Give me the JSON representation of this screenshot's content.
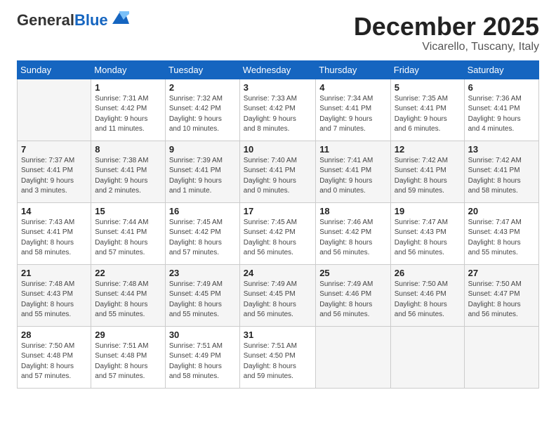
{
  "header": {
    "logo_general": "General",
    "logo_blue": "Blue",
    "title": "December 2025",
    "location": "Vicarello, Tuscany, Italy"
  },
  "days_of_week": [
    "Sunday",
    "Monday",
    "Tuesday",
    "Wednesday",
    "Thursday",
    "Friday",
    "Saturday"
  ],
  "weeks": [
    [
      {
        "num": "",
        "info": ""
      },
      {
        "num": "1",
        "info": "Sunrise: 7:31 AM\nSunset: 4:42 PM\nDaylight: 9 hours\nand 11 minutes."
      },
      {
        "num": "2",
        "info": "Sunrise: 7:32 AM\nSunset: 4:42 PM\nDaylight: 9 hours\nand 10 minutes."
      },
      {
        "num": "3",
        "info": "Sunrise: 7:33 AM\nSunset: 4:42 PM\nDaylight: 9 hours\nand 8 minutes."
      },
      {
        "num": "4",
        "info": "Sunrise: 7:34 AM\nSunset: 4:41 PM\nDaylight: 9 hours\nand 7 minutes."
      },
      {
        "num": "5",
        "info": "Sunrise: 7:35 AM\nSunset: 4:41 PM\nDaylight: 9 hours\nand 6 minutes."
      },
      {
        "num": "6",
        "info": "Sunrise: 7:36 AM\nSunset: 4:41 PM\nDaylight: 9 hours\nand 4 minutes."
      }
    ],
    [
      {
        "num": "7",
        "info": "Sunrise: 7:37 AM\nSunset: 4:41 PM\nDaylight: 9 hours\nand 3 minutes."
      },
      {
        "num": "8",
        "info": "Sunrise: 7:38 AM\nSunset: 4:41 PM\nDaylight: 9 hours\nand 2 minutes."
      },
      {
        "num": "9",
        "info": "Sunrise: 7:39 AM\nSunset: 4:41 PM\nDaylight: 9 hours\nand 1 minute."
      },
      {
        "num": "10",
        "info": "Sunrise: 7:40 AM\nSunset: 4:41 PM\nDaylight: 9 hours\nand 0 minutes."
      },
      {
        "num": "11",
        "info": "Sunrise: 7:41 AM\nSunset: 4:41 PM\nDaylight: 9 hours\nand 0 minutes."
      },
      {
        "num": "12",
        "info": "Sunrise: 7:42 AM\nSunset: 4:41 PM\nDaylight: 8 hours\nand 59 minutes."
      },
      {
        "num": "13",
        "info": "Sunrise: 7:42 AM\nSunset: 4:41 PM\nDaylight: 8 hours\nand 58 minutes."
      }
    ],
    [
      {
        "num": "14",
        "info": "Sunrise: 7:43 AM\nSunset: 4:41 PM\nDaylight: 8 hours\nand 58 minutes."
      },
      {
        "num": "15",
        "info": "Sunrise: 7:44 AM\nSunset: 4:41 PM\nDaylight: 8 hours\nand 57 minutes."
      },
      {
        "num": "16",
        "info": "Sunrise: 7:45 AM\nSunset: 4:42 PM\nDaylight: 8 hours\nand 57 minutes."
      },
      {
        "num": "17",
        "info": "Sunrise: 7:45 AM\nSunset: 4:42 PM\nDaylight: 8 hours\nand 56 minutes."
      },
      {
        "num": "18",
        "info": "Sunrise: 7:46 AM\nSunset: 4:42 PM\nDaylight: 8 hours\nand 56 minutes."
      },
      {
        "num": "19",
        "info": "Sunrise: 7:47 AM\nSunset: 4:43 PM\nDaylight: 8 hours\nand 56 minutes."
      },
      {
        "num": "20",
        "info": "Sunrise: 7:47 AM\nSunset: 4:43 PM\nDaylight: 8 hours\nand 55 minutes."
      }
    ],
    [
      {
        "num": "21",
        "info": "Sunrise: 7:48 AM\nSunset: 4:43 PM\nDaylight: 8 hours\nand 55 minutes."
      },
      {
        "num": "22",
        "info": "Sunrise: 7:48 AM\nSunset: 4:44 PM\nDaylight: 8 hours\nand 55 minutes."
      },
      {
        "num": "23",
        "info": "Sunrise: 7:49 AM\nSunset: 4:45 PM\nDaylight: 8 hours\nand 55 minutes."
      },
      {
        "num": "24",
        "info": "Sunrise: 7:49 AM\nSunset: 4:45 PM\nDaylight: 8 hours\nand 56 minutes."
      },
      {
        "num": "25",
        "info": "Sunrise: 7:49 AM\nSunset: 4:46 PM\nDaylight: 8 hours\nand 56 minutes."
      },
      {
        "num": "26",
        "info": "Sunrise: 7:50 AM\nSunset: 4:46 PM\nDaylight: 8 hours\nand 56 minutes."
      },
      {
        "num": "27",
        "info": "Sunrise: 7:50 AM\nSunset: 4:47 PM\nDaylight: 8 hours\nand 56 minutes."
      }
    ],
    [
      {
        "num": "28",
        "info": "Sunrise: 7:50 AM\nSunset: 4:48 PM\nDaylight: 8 hours\nand 57 minutes."
      },
      {
        "num": "29",
        "info": "Sunrise: 7:51 AM\nSunset: 4:48 PM\nDaylight: 8 hours\nand 57 minutes."
      },
      {
        "num": "30",
        "info": "Sunrise: 7:51 AM\nSunset: 4:49 PM\nDaylight: 8 hours\nand 58 minutes."
      },
      {
        "num": "31",
        "info": "Sunrise: 7:51 AM\nSunset: 4:50 PM\nDaylight: 8 hours\nand 59 minutes."
      },
      {
        "num": "",
        "info": ""
      },
      {
        "num": "",
        "info": ""
      },
      {
        "num": "",
        "info": ""
      }
    ]
  ]
}
